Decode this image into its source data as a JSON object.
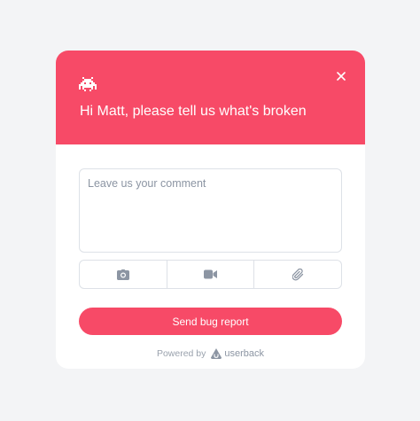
{
  "widget": {
    "header": {
      "title": "Hi Matt, please tell us what's broken",
      "bug_icon": "space-invader-icon",
      "close_icon": "close-icon",
      "background_color": "#f74a67"
    },
    "comment": {
      "placeholder": "Leave us your comment",
      "value": ""
    },
    "attachments": [
      {
        "icon": "camera-icon"
      },
      {
        "icon": "video-camera-icon"
      },
      {
        "icon": "paperclip-icon"
      }
    ],
    "send_label": "Send bug report",
    "footer": {
      "powered_by": "Powered by",
      "brand": "userback"
    }
  }
}
